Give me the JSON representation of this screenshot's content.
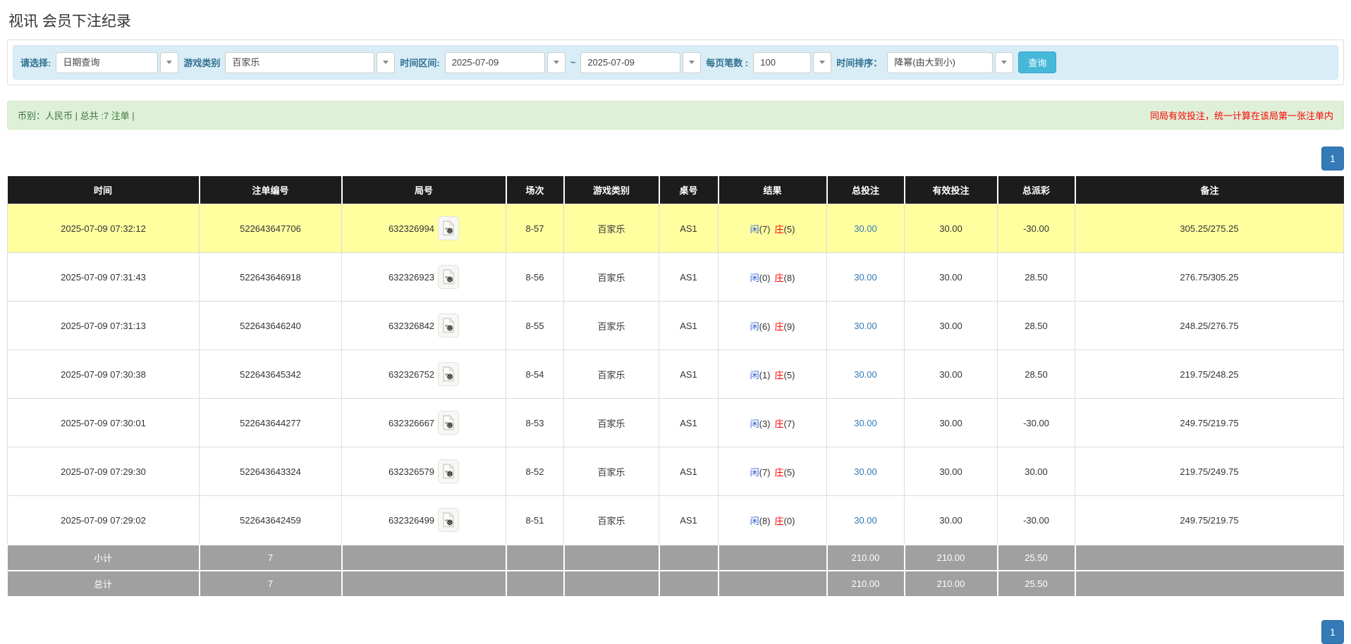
{
  "page": {
    "title": "视讯 会员下注纪录"
  },
  "filters": {
    "select_label": "请选择:",
    "select_value": "日期查询",
    "game_type_label": "游戏类别",
    "game_type_value": "百家乐",
    "time_range_label": "时间区间:",
    "time_from": "2025-07-09",
    "tilde": "~",
    "time_to": "2025-07-09",
    "page_size_label": "每页笔数 :",
    "page_size_value": "100",
    "sort_label": "时间排序：",
    "sort_value": "降幂(由大到小)",
    "search_button": "查询"
  },
  "summary": {
    "left": "币别：人民币 | 总共 :7 注单 |",
    "right_notice": "同局有效投注，统一计算在该局第一张注单内"
  },
  "pagination": {
    "page": "1"
  },
  "icons": {
    "combo_arrow": "chevron-down-icon",
    "round_video": "video-replay-icon"
  },
  "colors": {
    "accent_blue": "#337ab7",
    "search_button_blue": "#46b8da",
    "panel_blue": "#d9edf7",
    "info_green_bg": "#dff0d8",
    "info_green_text": "#3c763d",
    "notice_red": "#ff0000",
    "highlight_yellow": "#ffffa0",
    "summary_gray": "#a0a0a0",
    "header_black": "#1c1c1c",
    "player_blue": "#2f62d8",
    "banker_red": "#ff0000"
  },
  "table": {
    "headers": [
      "时间",
      "注单编号",
      "局号",
      "场次",
      "游戏类别",
      "桌号",
      "结果",
      "总投注",
      "有效投注",
      "总派彩",
      "备注"
    ],
    "rows": [
      {
        "time": "2025-07-09 07:32:12",
        "bet_id": "522643647706",
        "round_id": "632326994",
        "session": "8-57",
        "game": "百家乐",
        "table_id": "AS1",
        "player_label": "闲",
        "player_score": "(7)",
        "banker_label": "庄",
        "banker_score": "(5)",
        "total_bet": "30.00",
        "valid_bet": "30.00",
        "payout": "-30.00",
        "remark": "305.25/275.25",
        "highlight": true
      },
      {
        "time": "2025-07-09 07:31:43",
        "bet_id": "522643646918",
        "round_id": "632326923",
        "session": "8-56",
        "game": "百家乐",
        "table_id": "AS1",
        "player_label": "闲",
        "player_score": "(0)",
        "banker_label": "庄",
        "banker_score": "(8)",
        "total_bet": "30.00",
        "valid_bet": "30.00",
        "payout": "28.50",
        "remark": "276.75/305.25",
        "highlight": false
      },
      {
        "time": "2025-07-09 07:31:13",
        "bet_id": "522643646240",
        "round_id": "632326842",
        "session": "8-55",
        "game": "百家乐",
        "table_id": "AS1",
        "player_label": "闲",
        "player_score": "(6)",
        "banker_label": "庄",
        "banker_score": "(9)",
        "total_bet": "30.00",
        "valid_bet": "30.00",
        "payout": "28.50",
        "remark": "248.25/276.75",
        "highlight": false
      },
      {
        "time": "2025-07-09 07:30:38",
        "bet_id": "522643645342",
        "round_id": "632326752",
        "session": "8-54",
        "game": "百家乐",
        "table_id": "AS1",
        "player_label": "闲",
        "player_score": "(1)",
        "banker_label": "庄",
        "banker_score": "(5)",
        "total_bet": "30.00",
        "valid_bet": "30.00",
        "payout": "28.50",
        "remark": "219.75/248.25",
        "highlight": false
      },
      {
        "time": "2025-07-09 07:30:01",
        "bet_id": "522643644277",
        "round_id": "632326667",
        "session": "8-53",
        "game": "百家乐",
        "table_id": "AS1",
        "player_label": "闲",
        "player_score": "(3)",
        "banker_label": "庄",
        "banker_score": "(7)",
        "total_bet": "30.00",
        "valid_bet": "30.00",
        "payout": "-30.00",
        "remark": "249.75/219.75",
        "highlight": false
      },
      {
        "time": "2025-07-09 07:29:30",
        "bet_id": "522643643324",
        "round_id": "632326579",
        "session": "8-52",
        "game": "百家乐",
        "table_id": "AS1",
        "player_label": "闲",
        "player_score": "(7)",
        "banker_label": "庄",
        "banker_score": "(5)",
        "total_bet": "30.00",
        "valid_bet": "30.00",
        "payout": "30.00",
        "remark": "219.75/249.75",
        "highlight": false
      },
      {
        "time": "2025-07-09 07:29:02",
        "bet_id": "522643642459",
        "round_id": "632326499",
        "session": "8-51",
        "game": "百家乐",
        "table_id": "AS1",
        "player_label": "闲",
        "player_score": "(8)",
        "banker_label": "庄",
        "banker_score": "(0)",
        "total_bet": "30.00",
        "valid_bet": "30.00",
        "payout": "-30.00",
        "remark": "249.75/219.75",
        "highlight": false
      }
    ],
    "subtotal": {
      "label": "小计",
      "count": "7",
      "total_bet": "210.00",
      "valid_bet": "210.00",
      "payout": "25.50"
    },
    "total": {
      "label": "总计",
      "count": "7",
      "total_bet": "210.00",
      "valid_bet": "210.00",
      "payout": "25.50"
    }
  }
}
